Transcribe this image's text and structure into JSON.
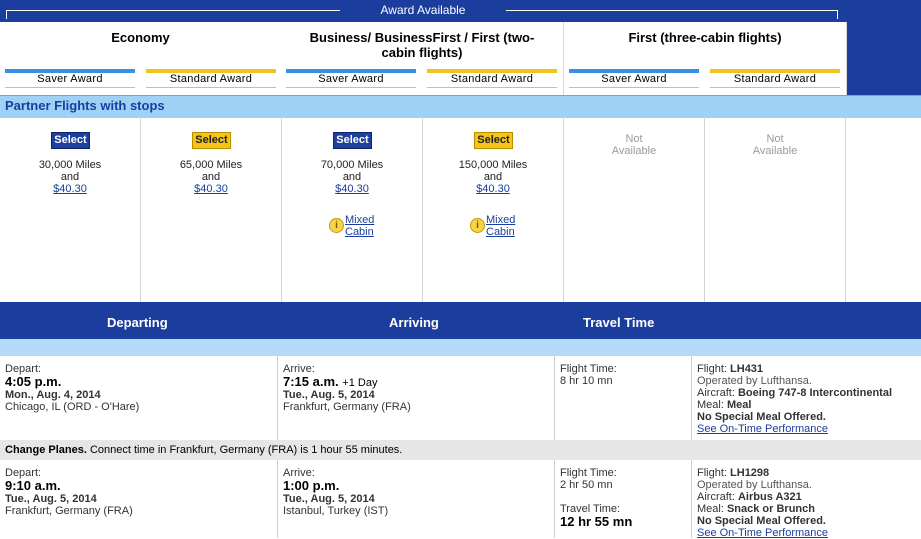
{
  "header": {
    "title": "Award Available"
  },
  "cabins": [
    {
      "title_line1": "Economy",
      "title_line2": "",
      "awards": [
        "Saver Award",
        "Standard Award"
      ]
    },
    {
      "title_line1": "Business/ BusinessFirst / First (two-",
      "title_line2": "cabin flights)",
      "awards": [
        "Saver Award",
        "Standard Award"
      ]
    },
    {
      "title_line1": "First (three-cabin flights)",
      "title_line2": "",
      "awards": [
        "Saver Award",
        "Standard Award"
      ]
    }
  ],
  "partner_section": {
    "label": "Partner Flights with stops"
  },
  "cells": [
    {
      "button": "Select",
      "miles": "30,000 Miles",
      "and": "and",
      "fee": "$40.30"
    },
    {
      "button": "Select",
      "miles": "65,000 Miles",
      "and": "and",
      "fee": "$40.30"
    },
    {
      "button": "Select",
      "miles": "70,000 Miles",
      "and": "and",
      "fee": "$40.30",
      "mixed1": "Mixed",
      "mixed2": "Cabin"
    },
    {
      "button": "Select",
      "miles": "150,000 Miles",
      "and": "and",
      "fee": "$40.30",
      "mixed1": "Mixed",
      "mixed2": "Cabin"
    },
    {
      "na1": "Not",
      "na2": "Available"
    },
    {
      "na1": "Not",
      "na2": "Available"
    }
  ],
  "table_headers": {
    "departing": "Departing",
    "arriving": "Arriving",
    "travel_time": "Travel Time"
  },
  "segments": [
    {
      "depart_label": "Depart:",
      "depart_time": "4:05 p.m.",
      "depart_date": "Mon., Aug. 4, 2014",
      "depart_city": "Chicago, IL (ORD - O'Hare)",
      "arrive_label": "Arrive:",
      "arrive_time": "7:15 a.m.",
      "arrive_extra": "+1 Day",
      "arrive_date": "Tue., Aug. 5, 2014",
      "arrive_city": "Frankfurt, Germany (FRA)",
      "flight_time_label": "Flight Time:",
      "flight_time": "8 hr 10 mn",
      "flight_label": "Flight:",
      "flight_no": "LH431",
      "operated": "Operated by Lufthansa.",
      "aircraft_label": "Aircraft:",
      "aircraft": "Boeing 747-8 Intercontinental",
      "meal_label": "Meal:",
      "meal": "Meal",
      "special_meal": "No Special Meal Offered.",
      "on_time": "See On-Time Performance"
    },
    {
      "depart_label": "Depart:",
      "depart_time": "9:10 a.m.",
      "depart_date": "Tue., Aug. 5, 2014",
      "depart_city": "Frankfurt, Germany (FRA)",
      "arrive_label": "Arrive:",
      "arrive_time": "1:00 p.m.",
      "arrive_extra": "",
      "arrive_date": "Tue., Aug. 5, 2014",
      "arrive_city": "Istanbul, Turkey (IST)",
      "flight_time_label": "Flight Time:",
      "flight_time": "2 hr 50 mn",
      "travel_time_label": "Travel Time:",
      "travel_time": "12 hr 55 mn",
      "flight_label": "Flight:",
      "flight_no": "LH1298",
      "operated": "Operated by Lufthansa.",
      "aircraft_label": "Aircraft:",
      "aircraft": "Airbus A321",
      "meal_label": "Meal:",
      "meal": "Snack or Brunch",
      "special_meal": "No Special Meal Offered.",
      "on_time": "See On-Time Performance"
    }
  ],
  "connection": {
    "bold": "Change Planes.",
    "text": " Connect time in Frankfurt, Germany (FRA) is 1 hour 55 minutes."
  },
  "colors": {
    "navy": "#1a3d9e",
    "saver_blue": "#3b8fe0",
    "standard_yellow": "#f2c21b",
    "light_blue": "#9fd1f7"
  }
}
